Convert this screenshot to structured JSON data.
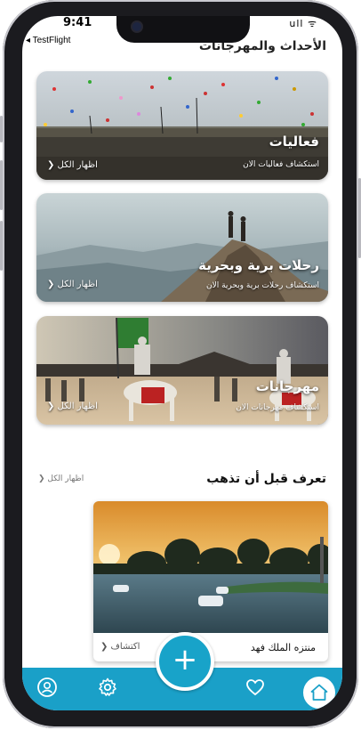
{
  "status": {
    "time": "9:41",
    "back_app": "TestFlight",
    "signal": "ull ᯤ"
  },
  "section": {
    "title": "الأحداث والمهرجانات"
  },
  "cards": [
    {
      "title": "فعاليات",
      "subtitle": "استكشاف فعاليات الان",
      "show_all": "اظهار الكل ❮"
    },
    {
      "title": "رحلات برية وبحرية",
      "subtitle": "استكشاف رحلات برية وبحرية الان",
      "show_all": "اظهار الكل ❮"
    },
    {
      "title": "مهرجانات",
      "subtitle": "استكشاف مهرجانات الان",
      "show_all": "اظهار الكل ❮"
    }
  ],
  "know_before": {
    "title": "تعرف قبل أن تذهب",
    "show_all": "اظهار الكل ❮"
  },
  "place": {
    "name": "منتزه الملك فهد",
    "explore": "اكتشاف ❮"
  },
  "tabbar": {
    "items": [
      "profile-icon",
      "settings-gear-icon",
      "add-plus-icon",
      "heart-icon",
      "home-icon"
    ],
    "fab_label": "+",
    "accent": "#1aa0c8"
  }
}
